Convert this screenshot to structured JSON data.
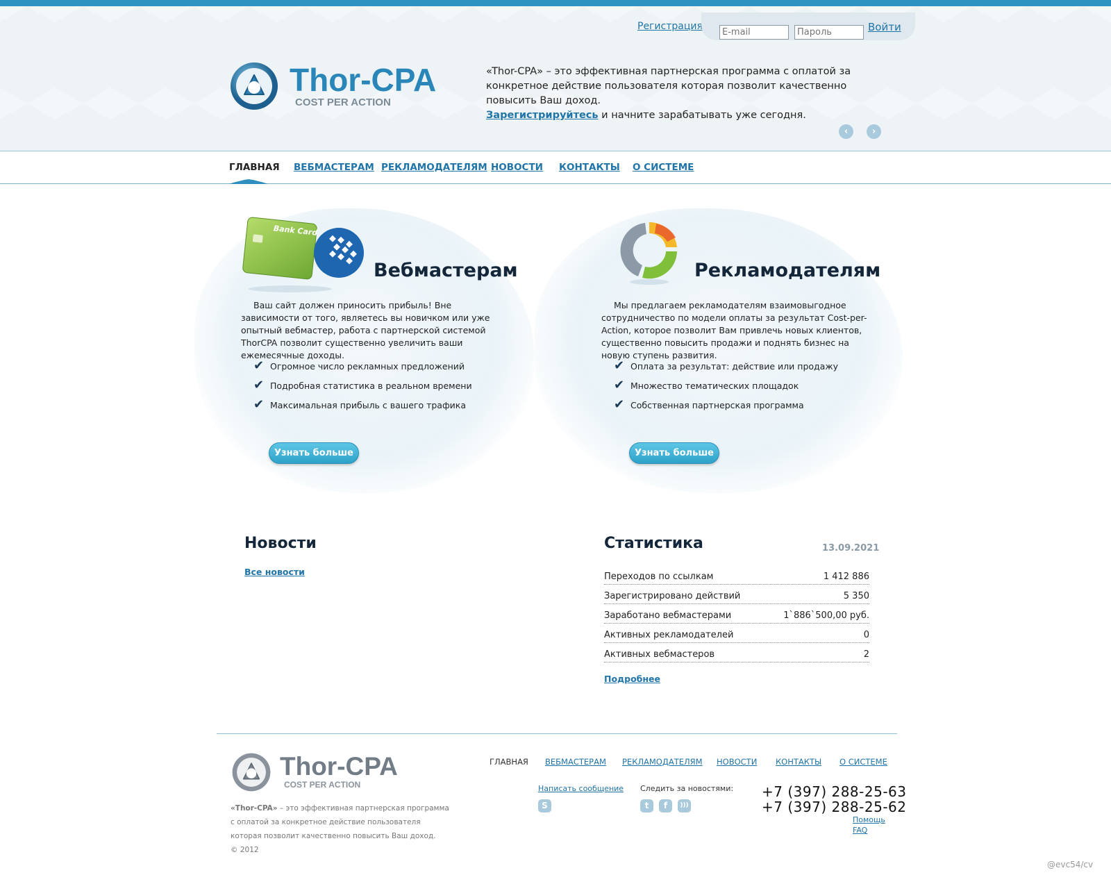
{
  "header": {
    "register_link": "Регистрация",
    "email_placeholder": "E-mail",
    "password_placeholder": "Пароль",
    "login_link": "Войти",
    "logo_name": "Thor-CPA",
    "logo_sub": "COST PER ACTION",
    "intro_brand": "«Thor-CPA»",
    "intro_text1": " – это эффективная партнерская программа с оплатой за конкретное действие пользователя которая позволит качественно повысить Ваш доход.",
    "intro_link": "Зарегистрируйтесь",
    "intro_text2": " и начните зарабатывать уже сегодня.",
    "prev_arrow": "‹",
    "next_arrow": "›"
  },
  "nav": {
    "items": [
      "ГЛАВНАЯ",
      "ВЕБМАСТЕРАМ",
      "РЕКЛАМОДАТЕЛЯМ",
      "НОВОСТИ",
      "КОНТАКТЫ",
      "О СИСТЕМЕ"
    ]
  },
  "webmasters": {
    "card_text": "Bank Card",
    "title": "Вебмастерам",
    "text": "Ваш сайт должен приносить прибыль! Вне зависимости от того, являетесь вы новичком или уже опытный вебмастер, работа с партнерской системой ThorCPA позволит существенно увеличить ваши ежемесячные доходы.",
    "checks": [
      "Огромное число рекламных предложений",
      "Подробная статистика в реальном времени",
      "Максимальная прибыль с вашего трафика"
    ],
    "button": "Узнать больше"
  },
  "advertisers": {
    "title": "Рекламодателям",
    "text": "Мы предлагаем рекламодателям взаимовыгодное сотрудничество по модели оплаты за результат Cost-per-Action, которое позволит Вам привлечь новых клиентов, существенно повысить продажи и поднять бизнес на новую ступень развития.",
    "checks": [
      "Оплата за результат: действие или продажу",
      "Множество тематических площадок",
      "Собственная партнерская программа"
    ],
    "button": "Узнать больше"
  },
  "news": {
    "title": "Новости",
    "all_link": "Все новости"
  },
  "stats": {
    "title": "Статистика",
    "date": "13.09.2021",
    "rows": [
      {
        "label": "Переходов по ссылкам",
        "value": "1 412 886"
      },
      {
        "label": "Зарегистрировано действий",
        "value": "5 350"
      },
      {
        "label": "Заработано вебмастерами",
        "value": "1`886`500,00 руб."
      },
      {
        "label": "Активных рекламодателей",
        "value": "0"
      },
      {
        "label": "Активных вебмастеров",
        "value": "2"
      }
    ],
    "more_link": "Подробнее"
  },
  "footer": {
    "logo_name": "Thor-CPA",
    "logo_sub": "COST PER ACTION",
    "desc_brand": "«Thor-CPA»",
    "desc_text": " – это эффективная партнерская программа с оплатой за конкретное действие пользователя которая позволит качественно повысить Ваш доход.",
    "copyright": "© 2012",
    "nav": [
      "ГЛАВНАЯ",
      "ВЕБМАСТЕРАМ",
      "РЕКЛАМОДАТЕЛЯМ",
      "НОВОСТИ",
      "КОНТАКТЫ",
      "О СИСТЕМЕ"
    ],
    "write_message": "Написать сообщение",
    "follow_news": "Следить за новостями:",
    "skype_glyph": "S",
    "twitter_glyph": "t",
    "facebook_glyph": "f",
    "rss_glyph": ")))",
    "phone1": "+7 (397) 288-25-63",
    "phone2": "+7 (397) 288-25-62",
    "help_link": "Помощь",
    "faq_link": "FAQ"
  },
  "watermark": "@evc54/cv",
  "colors": {
    "accent": "#2f93c2",
    "link": "#1f74a8",
    "button": "#3aaed4"
  }
}
